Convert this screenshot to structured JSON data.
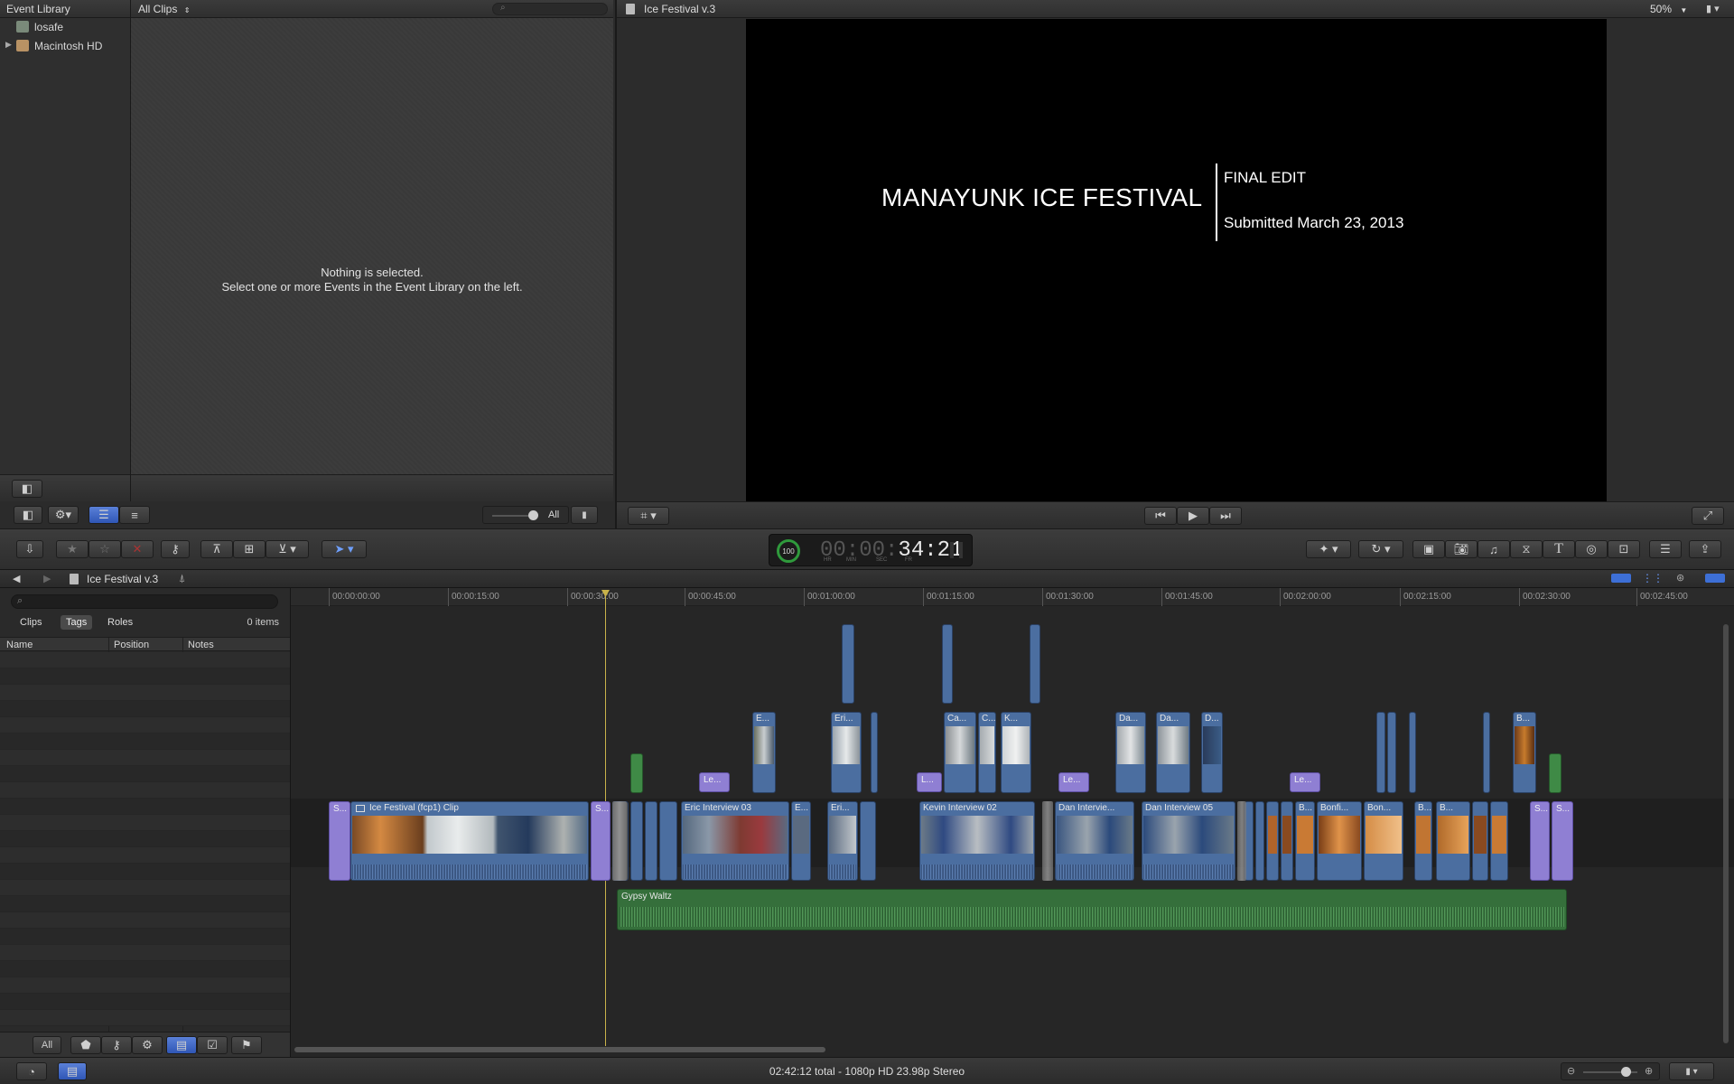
{
  "event_library": {
    "title": "Event Library",
    "items": [
      {
        "label": "losafe",
        "icon": "drive-icon"
      },
      {
        "label": "Macintosh HD",
        "icon": "hard-disk-icon"
      }
    ]
  },
  "event_browser": {
    "filter_label": "All Clips",
    "empty_line1": "Nothing is selected.",
    "empty_line2": "Select one or more Events in the Event Library on the left.",
    "all_label": "All"
  },
  "viewer": {
    "title": "Ice Festival v.3",
    "zoom": "50%",
    "frame": {
      "main_title": "MANAYUNK ICE FESTIVAL",
      "line1": "FINAL EDIT",
      "line2": "Submitted March 23, 2013"
    }
  },
  "toolbar": {
    "timecode": "34:21",
    "timecode_dim": "00:00:",
    "timecode_units": [
      "HR",
      "MIN",
      "SEC",
      "FR"
    ],
    "percent": "100"
  },
  "timeline_head": {
    "project": "Ice Festival v.3"
  },
  "timeline_index": {
    "tabs": [
      "Clips",
      "Tags",
      "Roles"
    ],
    "active_tab": "Tags",
    "count": "0 items",
    "columns": [
      "Name",
      "Position",
      "Notes"
    ],
    "all_button": "All"
  },
  "ruler": [
    "00:00:00:00",
    "00:00:15:00",
    "00:00:30:00",
    "00:00:45:00",
    "00:01:00:00",
    "00:01:15:00",
    "00:01:30:00",
    "00:01:45:00",
    "00:02:00:00",
    "00:02:15:00",
    "00:02:30:00",
    "00:02:45:00"
  ],
  "clips": {
    "primary": [
      "S...",
      "Ice Festival (fcp1) Clip",
      "S...",
      "Eric Interview 03",
      "E...",
      "Eri...",
      "Kevin Interview 02",
      "Dan Intervie...",
      "Dan Interview 05",
      "B...",
      "Bonfi...",
      "Bon...",
      "B...",
      "B...",
      "S...",
      "S..."
    ],
    "connected": [
      "E...",
      "Eri...",
      "Ca...",
      "C...",
      "K...",
      "Da...",
      "Da...",
      "D...",
      "B..."
    ],
    "titles": [
      "Le...",
      "L...",
      "Le...",
      "Le..."
    ],
    "audio": "Gypsy Waltz"
  },
  "status": {
    "summary": "02:42:12 total - 1080p HD 23.98p Stereo"
  }
}
